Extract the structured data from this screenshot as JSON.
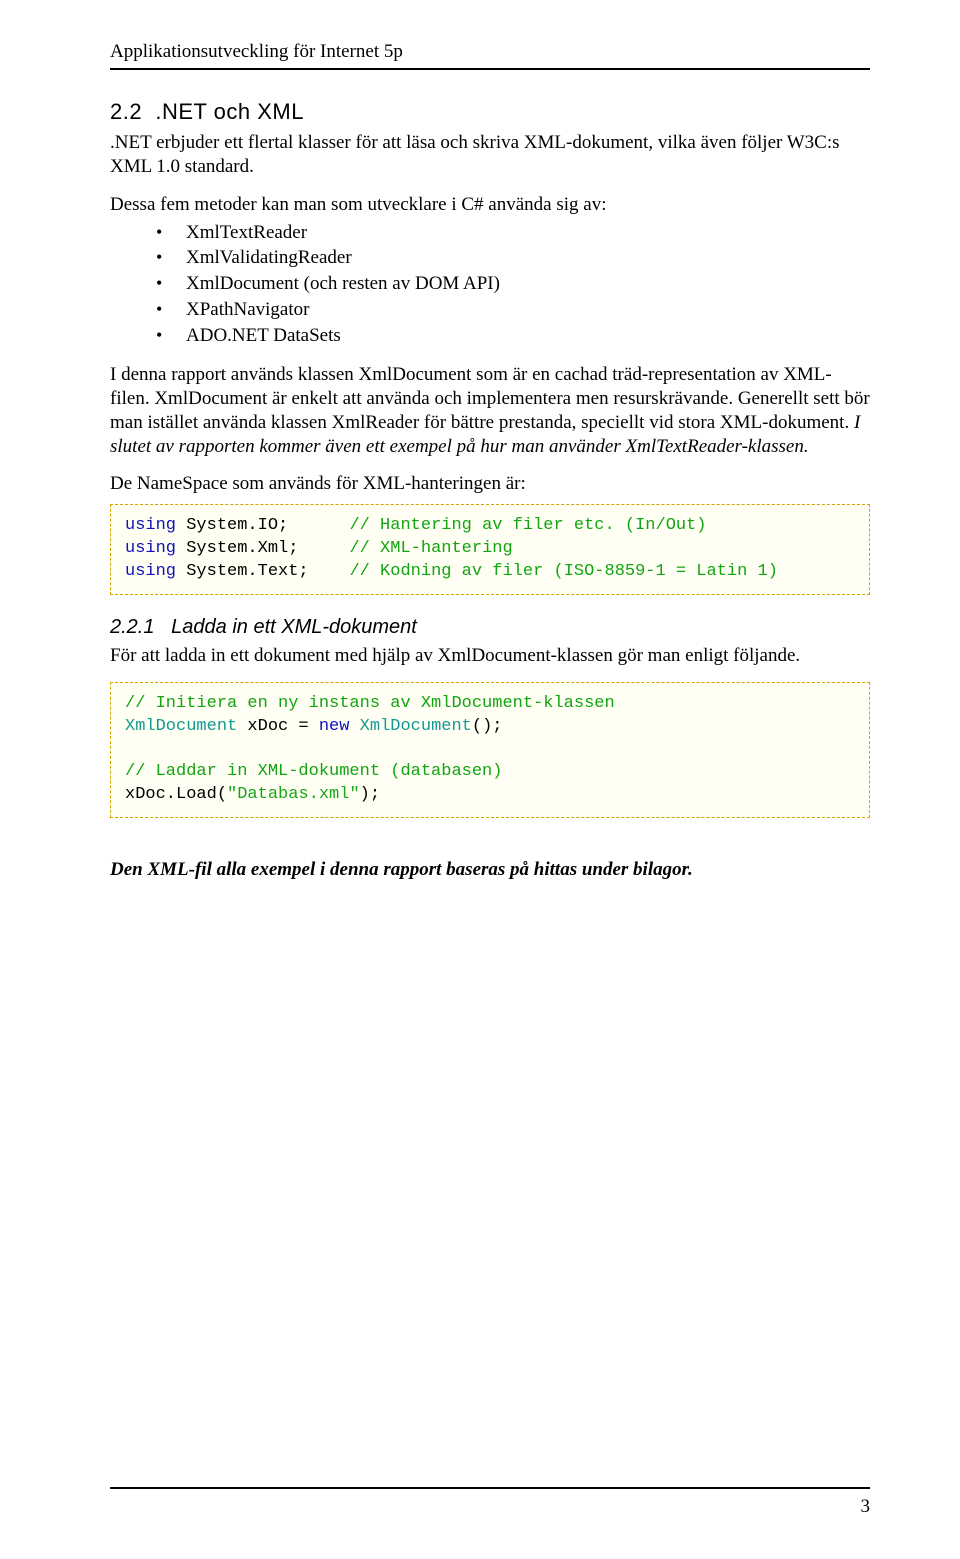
{
  "header": {
    "title": "Applikationsutveckling för Internet 5p"
  },
  "h22": {
    "num": "2.2",
    "title": ".NET och XML"
  },
  "p1": ".NET erbjuder ett flertal klasser för att läsa och skriva XML-dokument, vilka även följer W3C:s XML 1.0 standard.",
  "p2": "Dessa fem metoder kan man som utvecklare i C# använda sig av:",
  "bullets": [
    "XmlTextReader",
    "XmlValidatingReader",
    "XmlDocument (och resten av DOM API)",
    "XPathNavigator",
    "ADO.NET DataSets"
  ],
  "p3a": "I denna rapport används klassen XmlDocument som är en cachad träd-representation av XML-filen. XmlDocument är enkelt att använda och implementera men resurskrävande. Generellt sett bör man istället använda klassen XmlReader för bättre prestanda, speciellt vid stora XML-dokument. ",
  "p3b": "I slutet av rapporten kommer även ett exempel på hur man använder XmlTextReader-klassen.",
  "p4": "De NameSpace som används för XML-hanteringen är:",
  "code1": {
    "l1a": "using",
    "l1b": " System.IO;      ",
    "l1c": "// Hantering av filer etc. (In/Out)",
    "l2a": "using",
    "l2b": " System.Xml;     ",
    "l2c": "// XML-hantering",
    "l3a": "using",
    "l3b": " System.Text;    ",
    "l3c": "// Kodning av filer (ISO-8859-1 = Latin 1)"
  },
  "h221": {
    "num": "2.2.1",
    "title": "Ladda in ett XML-dokument"
  },
  "p5": "För att ladda in ett dokument med hjälp av XmlDocument-klassen gör man enligt följande.",
  "code2": {
    "c1": "// Initiera en ny instans av XmlDocument-klassen",
    "t1": "XmlDocument",
    "v1": " xDoc = ",
    "kw1": "new",
    "t2": " XmlDocument",
    "rest1": "();",
    "blank": "",
    "c2": "// Laddar in XML-dokument (databasen)",
    "l4a": "xDoc.Load(",
    "l4b": "\"Databas.xml\"",
    "l4c": ");"
  },
  "p6": "Den XML-fil alla exempel i denna rapport baseras på hittas under bilagor.",
  "page_number": "3"
}
